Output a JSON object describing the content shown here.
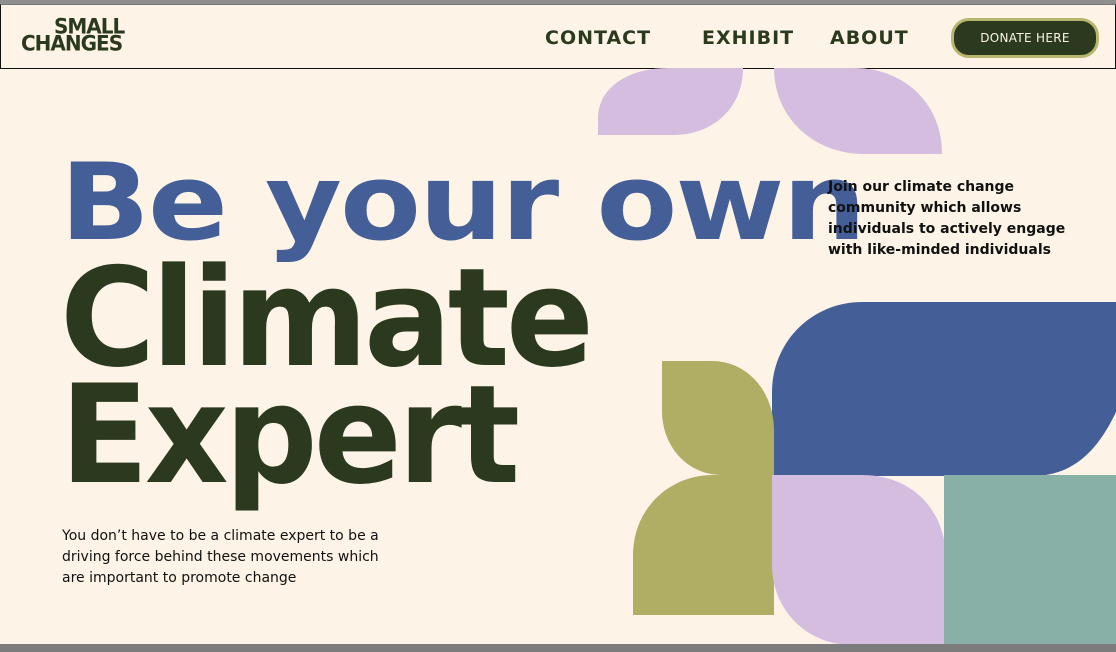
{
  "brand": {
    "line1": "SMALL",
    "line2": "CHANGES"
  },
  "nav": {
    "contact": "CONTACT",
    "exhibit": "EXHIBIT",
    "about": "ABOUT",
    "donate": "DONATE HERE"
  },
  "hero": {
    "line1": "Be your own",
    "line2": "Climate",
    "line3": "Expert",
    "intro": "Join our climate change community which allows individuals to actively engage with like-minded individuals",
    "subtext": "You don’t have to be a climate expert to be a driving force behind these movements which are important to promote change"
  },
  "colors": {
    "background": "#fdf3e7",
    "dark_green": "#2b3a1e",
    "blue": "#445f98",
    "lavender": "#d5bddf",
    "olive": "#b0ad64",
    "teal": "#89b0a6"
  }
}
